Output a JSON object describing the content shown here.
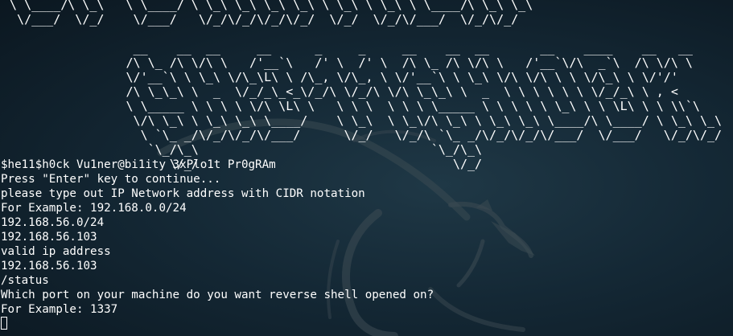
{
  "terminal": {
    "ascii_banner": [
      " \\ \\____/\\ \\_\\   \\ \\____/ \\ \\_\\ \\_\\ \\_\\ \\_\\ \\ \\_\\ \\ \\_\\ \\ \\____/\\ \\_\\ \\_\\",
      "  \\/___/  \\/_/    \\/___/   \\/_/\\/_/\\/_/\\/_/  \\/_/  \\/_/\\/___/  \\/_/\\/_/",
      "",
      "                  __    __  __     __      _     _     __    __  __       __    ____    __   __",
      "                 /\\ \\_ /\\ \\/\\ \\   /'__`\\   /' \\  /' \\  /\\ \\_ /\\ \\/\\ \\   /'__`\\/\\  _`\\  /\\ \\/\\ \\",
      "                 \\/'__`\\ \\ \\_\\ \\/\\_\\L\\ \\ /\\_, \\/\\_, \\ \\/'__`\\ \\ \\_\\ \\/\\ \\/\\ \\ \\ \\/\\_\\ \\ \\/'/'",
      "                 /\\ \\_\\_\\ \\  _  \\/_/_\\_<_\\/_/\\ \\/_/\\ \\/\\ \\_\\_\\ \\  _  \\ \\ \\ \\ \\ \\ \\/_/_\\ \\ , <",
      "                 \\ \\_____ \\ \\ \\ \\ \\/\\ \\L\\ \\   \\ \\ \\  \\ \\ \\ \\_____ \\ \\ \\ \\ \\ \\_\\ \\ \\ \\L\\ \\ \\ \\\\`\\",
      "                  \\/\\ \\_\\ \\ \\_\\ \\_\\ \\____/    \\ \\_\\  \\ \\_\\/\\ \\_\\ \\ \\_\\ \\_\\ \\____/\\ \\____/ \\ \\_\\ \\_\\",
      "                   \\ `\\_ _/\\/_/\\/_/\\/___/      \\/_/   \\/_/\\ `\\_ _/\\/_/\\/_/\\/___/  \\/___/   \\/_/\\/_/",
      "                    `\\_/\\_\\                                `\\_/\\_\\",
      "                       \\/_/                                   \\/_/"
    ],
    "lines": [
      "$he11$h0ck Vu1ner@bi1ity 3xPlo1t Pr0gRAm",
      "Press \"Enter\" key to continue...",
      "please type out IP Network address with CIDR notation",
      "For Example: 192.168.0.0/24",
      "192.168.56.0/24",
      "192.168.56.103",
      "valid ip address",
      "192.168.56.103",
      "/status",
      "Which port on your machine do you want reverse shell opened on?",
      "For Example: 1337"
    ]
  }
}
